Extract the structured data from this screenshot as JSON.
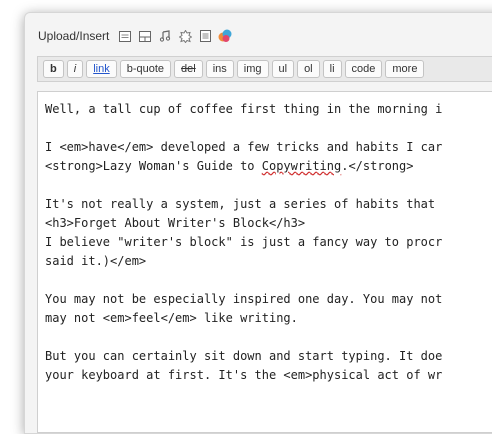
{
  "upload": {
    "label": "Upload/Insert",
    "icons": [
      "image-icon",
      "gallery-icon",
      "audio-icon",
      "settings-icon",
      "document-icon",
      "media-icon"
    ]
  },
  "toolbar": {
    "buttons": [
      "b",
      "i",
      "link",
      "b-quote",
      "del",
      "ins",
      "img",
      "ul",
      "ol",
      "li",
      "code",
      "more"
    ]
  },
  "editor": {
    "lines": [
      "Well, a tall cup of coffee first thing in the morning i",
      "",
      "I <em>have</em> developed a few tricks and habits I car",
      "<strong>Lazy Woman's Guide to ",
      "Copywriting",
      ".</strong>",
      "",
      "It's not really a system, just a series of habits that ",
      "<h3>Forget About Writer's Block</h3>",
      "I believe \"writer's block\" is just a fancy way to procr",
      "said it.)</em>",
      "",
      "You may not be especially inspired one day. You may not",
      "may not <em>feel</em> like writing.",
      "",
      "But you can certainly sit down and start typing. It doe",
      "your keyboard at first. It's the <em>physical act of wr"
    ]
  }
}
